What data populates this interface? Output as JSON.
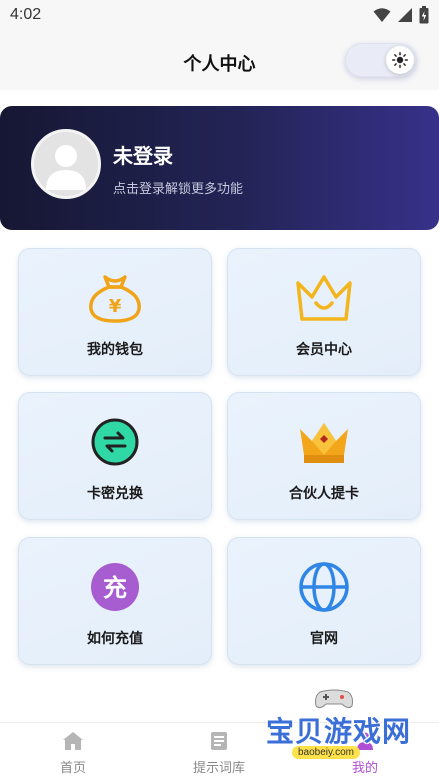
{
  "status": {
    "time": "4:02"
  },
  "header": {
    "title": "个人中心"
  },
  "profile": {
    "name": "未登录",
    "subtitle": "点击登录解锁更多功能"
  },
  "grid": [
    {
      "label": "我的钱包",
      "icon": "money-bag-icon",
      "color": "#f0a418"
    },
    {
      "label": "会员中心",
      "icon": "crown-icon",
      "color": "#f3b51c"
    },
    {
      "label": "卡密兑换",
      "icon": "exchange-icon",
      "color": "#2fd8a5"
    },
    {
      "label": "合伙人提卡",
      "icon": "gold-crown-icon",
      "color": "#f3a61a"
    },
    {
      "label": "如何充值",
      "icon": "recharge-icon",
      "glyph": "充",
      "color": "#a75cd0"
    },
    {
      "label": "官网",
      "icon": "globe-icon",
      "color": "#2f86e6"
    }
  ],
  "nav": [
    {
      "label": "首页",
      "icon": "home-icon"
    },
    {
      "label": "提示词库",
      "icon": "book-icon"
    },
    {
      "label": "我的",
      "icon": "user-icon",
      "active": true
    }
  ],
  "watermark": {
    "text": "宝贝游戏网",
    "url": "baobeiy.com"
  },
  "colors": {
    "accent": "#b04fd6",
    "card_gradient_start": "#161733",
    "card_gradient_end": "#38318a"
  }
}
